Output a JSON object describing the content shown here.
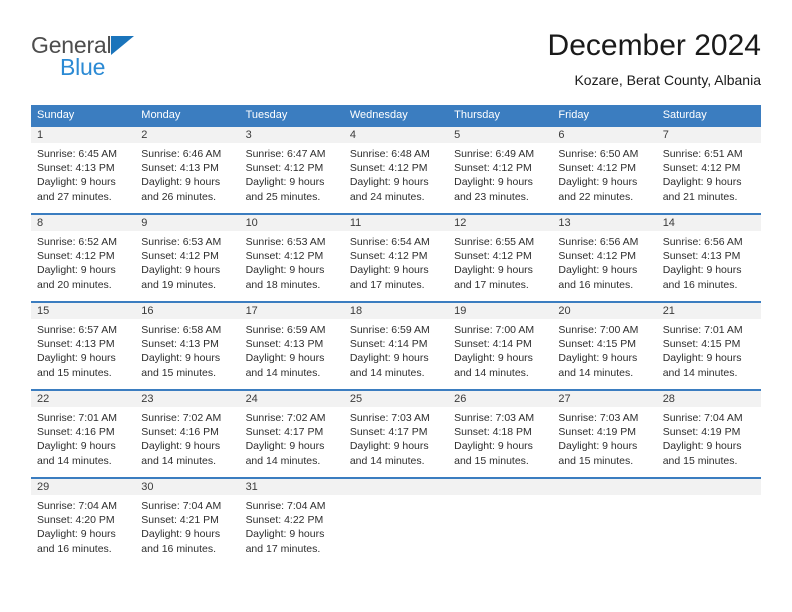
{
  "brand": {
    "name_top": "General",
    "name_bottom": "Blue",
    "triangle_color": "#1a74bb",
    "blue_color": "#2b8ad4"
  },
  "header": {
    "title": "December 2024",
    "subtitle": "Kozare, Berat County, Albania"
  },
  "theme": {
    "header_blue": "#3b7dc0",
    "day_band_gray": "#f2f2f2"
  },
  "weekdays": [
    "Sunday",
    "Monday",
    "Tuesday",
    "Wednesday",
    "Thursday",
    "Friday",
    "Saturday"
  ],
  "weeks": [
    [
      {
        "day": "1",
        "sunrise": "Sunrise: 6:45 AM",
        "sunset": "Sunset: 4:13 PM",
        "daylight_line1": "Daylight: 9 hours",
        "daylight_line2": "and 27 minutes."
      },
      {
        "day": "2",
        "sunrise": "Sunrise: 6:46 AM",
        "sunset": "Sunset: 4:13 PM",
        "daylight_line1": "Daylight: 9 hours",
        "daylight_line2": "and 26 minutes."
      },
      {
        "day": "3",
        "sunrise": "Sunrise: 6:47 AM",
        "sunset": "Sunset: 4:12 PM",
        "daylight_line1": "Daylight: 9 hours",
        "daylight_line2": "and 25 minutes."
      },
      {
        "day": "4",
        "sunrise": "Sunrise: 6:48 AM",
        "sunset": "Sunset: 4:12 PM",
        "daylight_line1": "Daylight: 9 hours",
        "daylight_line2": "and 24 minutes."
      },
      {
        "day": "5",
        "sunrise": "Sunrise: 6:49 AM",
        "sunset": "Sunset: 4:12 PM",
        "daylight_line1": "Daylight: 9 hours",
        "daylight_line2": "and 23 minutes."
      },
      {
        "day": "6",
        "sunrise": "Sunrise: 6:50 AM",
        "sunset": "Sunset: 4:12 PM",
        "daylight_line1": "Daylight: 9 hours",
        "daylight_line2": "and 22 minutes."
      },
      {
        "day": "7",
        "sunrise": "Sunrise: 6:51 AM",
        "sunset": "Sunset: 4:12 PM",
        "daylight_line1": "Daylight: 9 hours",
        "daylight_line2": "and 21 minutes."
      }
    ],
    [
      {
        "day": "8",
        "sunrise": "Sunrise: 6:52 AM",
        "sunset": "Sunset: 4:12 PM",
        "daylight_line1": "Daylight: 9 hours",
        "daylight_line2": "and 20 minutes."
      },
      {
        "day": "9",
        "sunrise": "Sunrise: 6:53 AM",
        "sunset": "Sunset: 4:12 PM",
        "daylight_line1": "Daylight: 9 hours",
        "daylight_line2": "and 19 minutes."
      },
      {
        "day": "10",
        "sunrise": "Sunrise: 6:53 AM",
        "sunset": "Sunset: 4:12 PM",
        "daylight_line1": "Daylight: 9 hours",
        "daylight_line2": "and 18 minutes."
      },
      {
        "day": "11",
        "sunrise": "Sunrise: 6:54 AM",
        "sunset": "Sunset: 4:12 PM",
        "daylight_line1": "Daylight: 9 hours",
        "daylight_line2": "and 17 minutes."
      },
      {
        "day": "12",
        "sunrise": "Sunrise: 6:55 AM",
        "sunset": "Sunset: 4:12 PM",
        "daylight_line1": "Daylight: 9 hours",
        "daylight_line2": "and 17 minutes."
      },
      {
        "day": "13",
        "sunrise": "Sunrise: 6:56 AM",
        "sunset": "Sunset: 4:12 PM",
        "daylight_line1": "Daylight: 9 hours",
        "daylight_line2": "and 16 minutes."
      },
      {
        "day": "14",
        "sunrise": "Sunrise: 6:56 AM",
        "sunset": "Sunset: 4:13 PM",
        "daylight_line1": "Daylight: 9 hours",
        "daylight_line2": "and 16 minutes."
      }
    ],
    [
      {
        "day": "15",
        "sunrise": "Sunrise: 6:57 AM",
        "sunset": "Sunset: 4:13 PM",
        "daylight_line1": "Daylight: 9 hours",
        "daylight_line2": "and 15 minutes."
      },
      {
        "day": "16",
        "sunrise": "Sunrise: 6:58 AM",
        "sunset": "Sunset: 4:13 PM",
        "daylight_line1": "Daylight: 9 hours",
        "daylight_line2": "and 15 minutes."
      },
      {
        "day": "17",
        "sunrise": "Sunrise: 6:59 AM",
        "sunset": "Sunset: 4:13 PM",
        "daylight_line1": "Daylight: 9 hours",
        "daylight_line2": "and 14 minutes."
      },
      {
        "day": "18",
        "sunrise": "Sunrise: 6:59 AM",
        "sunset": "Sunset: 4:14 PM",
        "daylight_line1": "Daylight: 9 hours",
        "daylight_line2": "and 14 minutes."
      },
      {
        "day": "19",
        "sunrise": "Sunrise: 7:00 AM",
        "sunset": "Sunset: 4:14 PM",
        "daylight_line1": "Daylight: 9 hours",
        "daylight_line2": "and 14 minutes."
      },
      {
        "day": "20",
        "sunrise": "Sunrise: 7:00 AM",
        "sunset": "Sunset: 4:15 PM",
        "daylight_line1": "Daylight: 9 hours",
        "daylight_line2": "and 14 minutes."
      },
      {
        "day": "21",
        "sunrise": "Sunrise: 7:01 AM",
        "sunset": "Sunset: 4:15 PM",
        "daylight_line1": "Daylight: 9 hours",
        "daylight_line2": "and 14 minutes."
      }
    ],
    [
      {
        "day": "22",
        "sunrise": "Sunrise: 7:01 AM",
        "sunset": "Sunset: 4:16 PM",
        "daylight_line1": "Daylight: 9 hours",
        "daylight_line2": "and 14 minutes."
      },
      {
        "day": "23",
        "sunrise": "Sunrise: 7:02 AM",
        "sunset": "Sunset: 4:16 PM",
        "daylight_line1": "Daylight: 9 hours",
        "daylight_line2": "and 14 minutes."
      },
      {
        "day": "24",
        "sunrise": "Sunrise: 7:02 AM",
        "sunset": "Sunset: 4:17 PM",
        "daylight_line1": "Daylight: 9 hours",
        "daylight_line2": "and 14 minutes."
      },
      {
        "day": "25",
        "sunrise": "Sunrise: 7:03 AM",
        "sunset": "Sunset: 4:17 PM",
        "daylight_line1": "Daylight: 9 hours",
        "daylight_line2": "and 14 minutes."
      },
      {
        "day": "26",
        "sunrise": "Sunrise: 7:03 AM",
        "sunset": "Sunset: 4:18 PM",
        "daylight_line1": "Daylight: 9 hours",
        "daylight_line2": "and 15 minutes."
      },
      {
        "day": "27",
        "sunrise": "Sunrise: 7:03 AM",
        "sunset": "Sunset: 4:19 PM",
        "daylight_line1": "Daylight: 9 hours",
        "daylight_line2": "and 15 minutes."
      },
      {
        "day": "28",
        "sunrise": "Sunrise: 7:04 AM",
        "sunset": "Sunset: 4:19 PM",
        "daylight_line1": "Daylight: 9 hours",
        "daylight_line2": "and 15 minutes."
      }
    ],
    [
      {
        "day": "29",
        "sunrise": "Sunrise: 7:04 AM",
        "sunset": "Sunset: 4:20 PM",
        "daylight_line1": "Daylight: 9 hours",
        "daylight_line2": "and 16 minutes."
      },
      {
        "day": "30",
        "sunrise": "Sunrise: 7:04 AM",
        "sunset": "Sunset: 4:21 PM",
        "daylight_line1": "Daylight: 9 hours",
        "daylight_line2": "and 16 minutes."
      },
      {
        "day": "31",
        "sunrise": "Sunrise: 7:04 AM",
        "sunset": "Sunset: 4:22 PM",
        "daylight_line1": "Daylight: 9 hours",
        "daylight_line2": "and 17 minutes."
      },
      {
        "day": "",
        "sunrise": "",
        "sunset": "",
        "daylight_line1": "",
        "daylight_line2": ""
      },
      {
        "day": "",
        "sunrise": "",
        "sunset": "",
        "daylight_line1": "",
        "daylight_line2": ""
      },
      {
        "day": "",
        "sunrise": "",
        "sunset": "",
        "daylight_line1": "",
        "daylight_line2": ""
      },
      {
        "day": "",
        "sunrise": "",
        "sunset": "",
        "daylight_line1": "",
        "daylight_line2": ""
      }
    ]
  ]
}
